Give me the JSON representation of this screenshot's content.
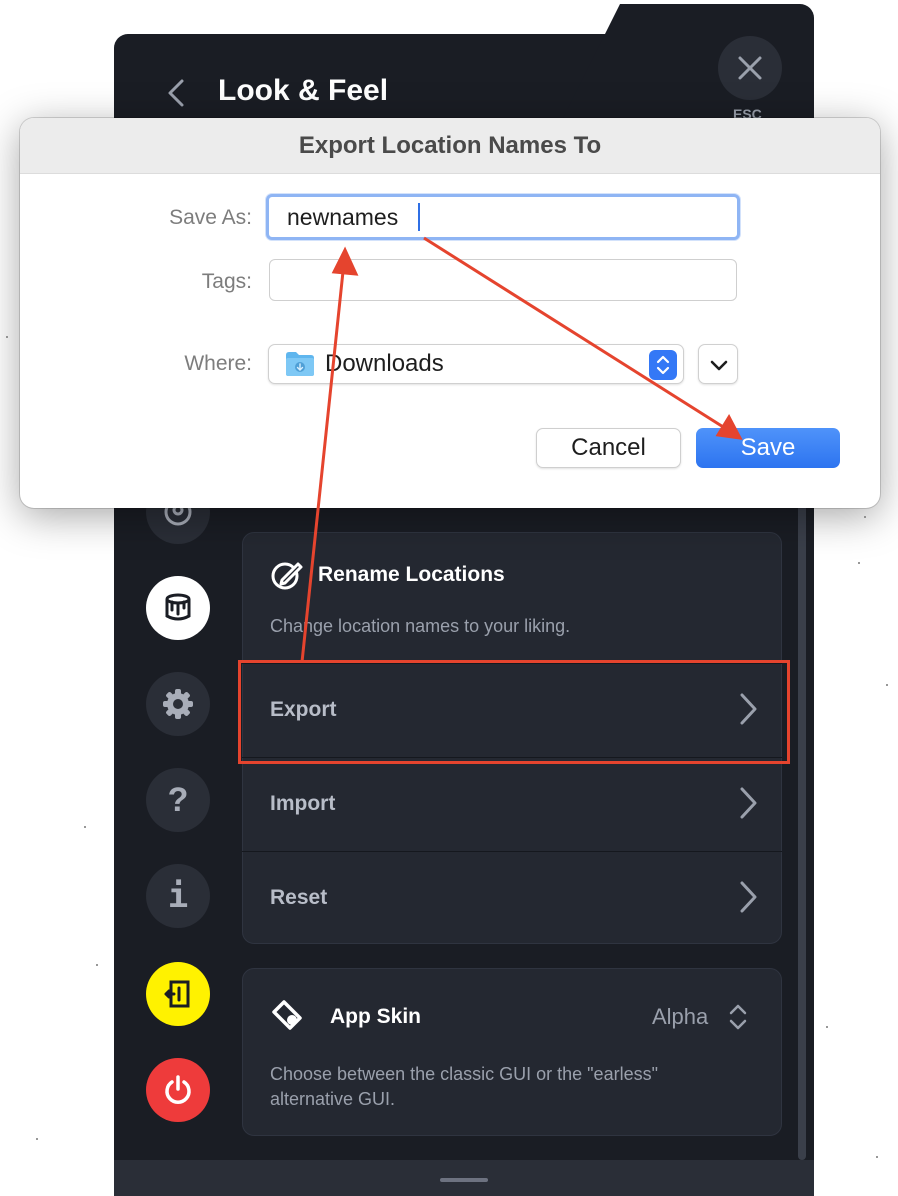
{
  "app": {
    "header_title": "Look & Feel",
    "back_icon": "chevron-left-icon",
    "close_icon": "close-icon",
    "close_hint": "ESC"
  },
  "sidebar": {
    "items": [
      {
        "icon": "profile-icon",
        "active": false
      },
      {
        "icon": "paint-bucket-icon",
        "active": true
      },
      {
        "icon": "gear-icon",
        "active": false
      },
      {
        "icon": "help-icon",
        "active": false,
        "glyph": "?"
      },
      {
        "icon": "info-icon",
        "active": false,
        "glyph": "i"
      },
      {
        "icon": "logout-icon",
        "color": "#fff200"
      },
      {
        "icon": "power-icon",
        "color": "#ee3b3b"
      }
    ]
  },
  "rename_card": {
    "icon": "rename-pencil-icon",
    "title": "Rename Locations",
    "description": "Change location names to your liking.",
    "rows": [
      {
        "label": "Export"
      },
      {
        "label": "Import"
      },
      {
        "label": "Reset"
      }
    ]
  },
  "skin_card": {
    "icon": "app-skin-icon",
    "title": "App Skin",
    "value": "Alpha",
    "description_line1": "Choose between the classic GUI or the \"earless\"",
    "description_line2": "alternative GUI."
  },
  "dialog": {
    "title": "Export Location Names To",
    "save_as_label": "Save As:",
    "save_as_value": "newnames",
    "tags_label": "Tags:",
    "tags_value": "",
    "where_label": "Where:",
    "where_value": "Downloads",
    "cancel_label": "Cancel",
    "save_label": "Save"
  },
  "colors": {
    "accent": "#3478f6",
    "annotation": "#e5442e",
    "app_background": "#1a1d24",
    "card_background": "#242831"
  }
}
